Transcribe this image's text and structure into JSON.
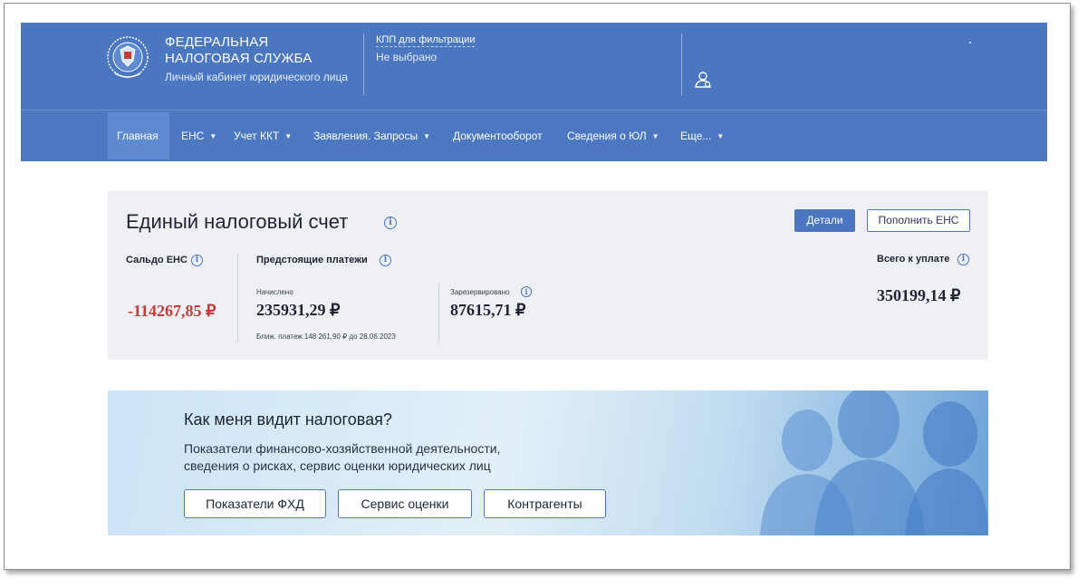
{
  "header": {
    "brand_line1": "ФЕДЕРАЛЬНАЯ",
    "brand_line2": "НАЛОГОВАЯ СЛУЖБА",
    "brand_line3": "Личный кабинет юридического лица",
    "kpp_label": "КПП для фильтрации",
    "kpp_value": "Не выбрано",
    "user_icon": "user-icon"
  },
  "nav": {
    "items": [
      {
        "label": "Главная",
        "active": true
      },
      {
        "label": "ЕНС",
        "caret": true
      },
      {
        "label": "Учет ККТ",
        "caret": true
      },
      {
        "label": "Заявления. Запросы",
        "caret": true
      },
      {
        "label": "Документооборот"
      },
      {
        "label": "Сведения о ЮЛ",
        "caret": true
      },
      {
        "label": "Еще...",
        "caret": true
      }
    ]
  },
  "ens": {
    "title": "Единый налоговый счет",
    "details_button": "Детали",
    "topup_button": "Пополнить ЕНС",
    "balance_label": "Сальдо ЕНС",
    "balance_value": "-114267,85 ₽",
    "upcoming_label": "Предстоящие платежи",
    "accrued_label": "Начислено",
    "accrued_value": "235931,29 ₽",
    "reserved_label": "Зарезервировано",
    "reserved_value": "87615,71 ₽",
    "next_payment_note": "Ближ. платеж 148 261,90 ₽ до 28.06.2023",
    "total_label": "Всего к уплате",
    "total_value": "350199,14 ₽"
  },
  "banner": {
    "title": "Как меня видит налоговая?",
    "text_line1": "Показатели финансово-хозяйственной деятельности,",
    "text_line2": "сведения о рисках, сервис оценки юридических лиц",
    "btn_fhd": "Показатели ФХД",
    "btn_rating": "Сервис оценки",
    "btn_contractors": "Контрагенты"
  },
  "colors": {
    "header_bg": "#4a77c0",
    "negative": "#c63a3a",
    "accent": "#4a77c0"
  }
}
